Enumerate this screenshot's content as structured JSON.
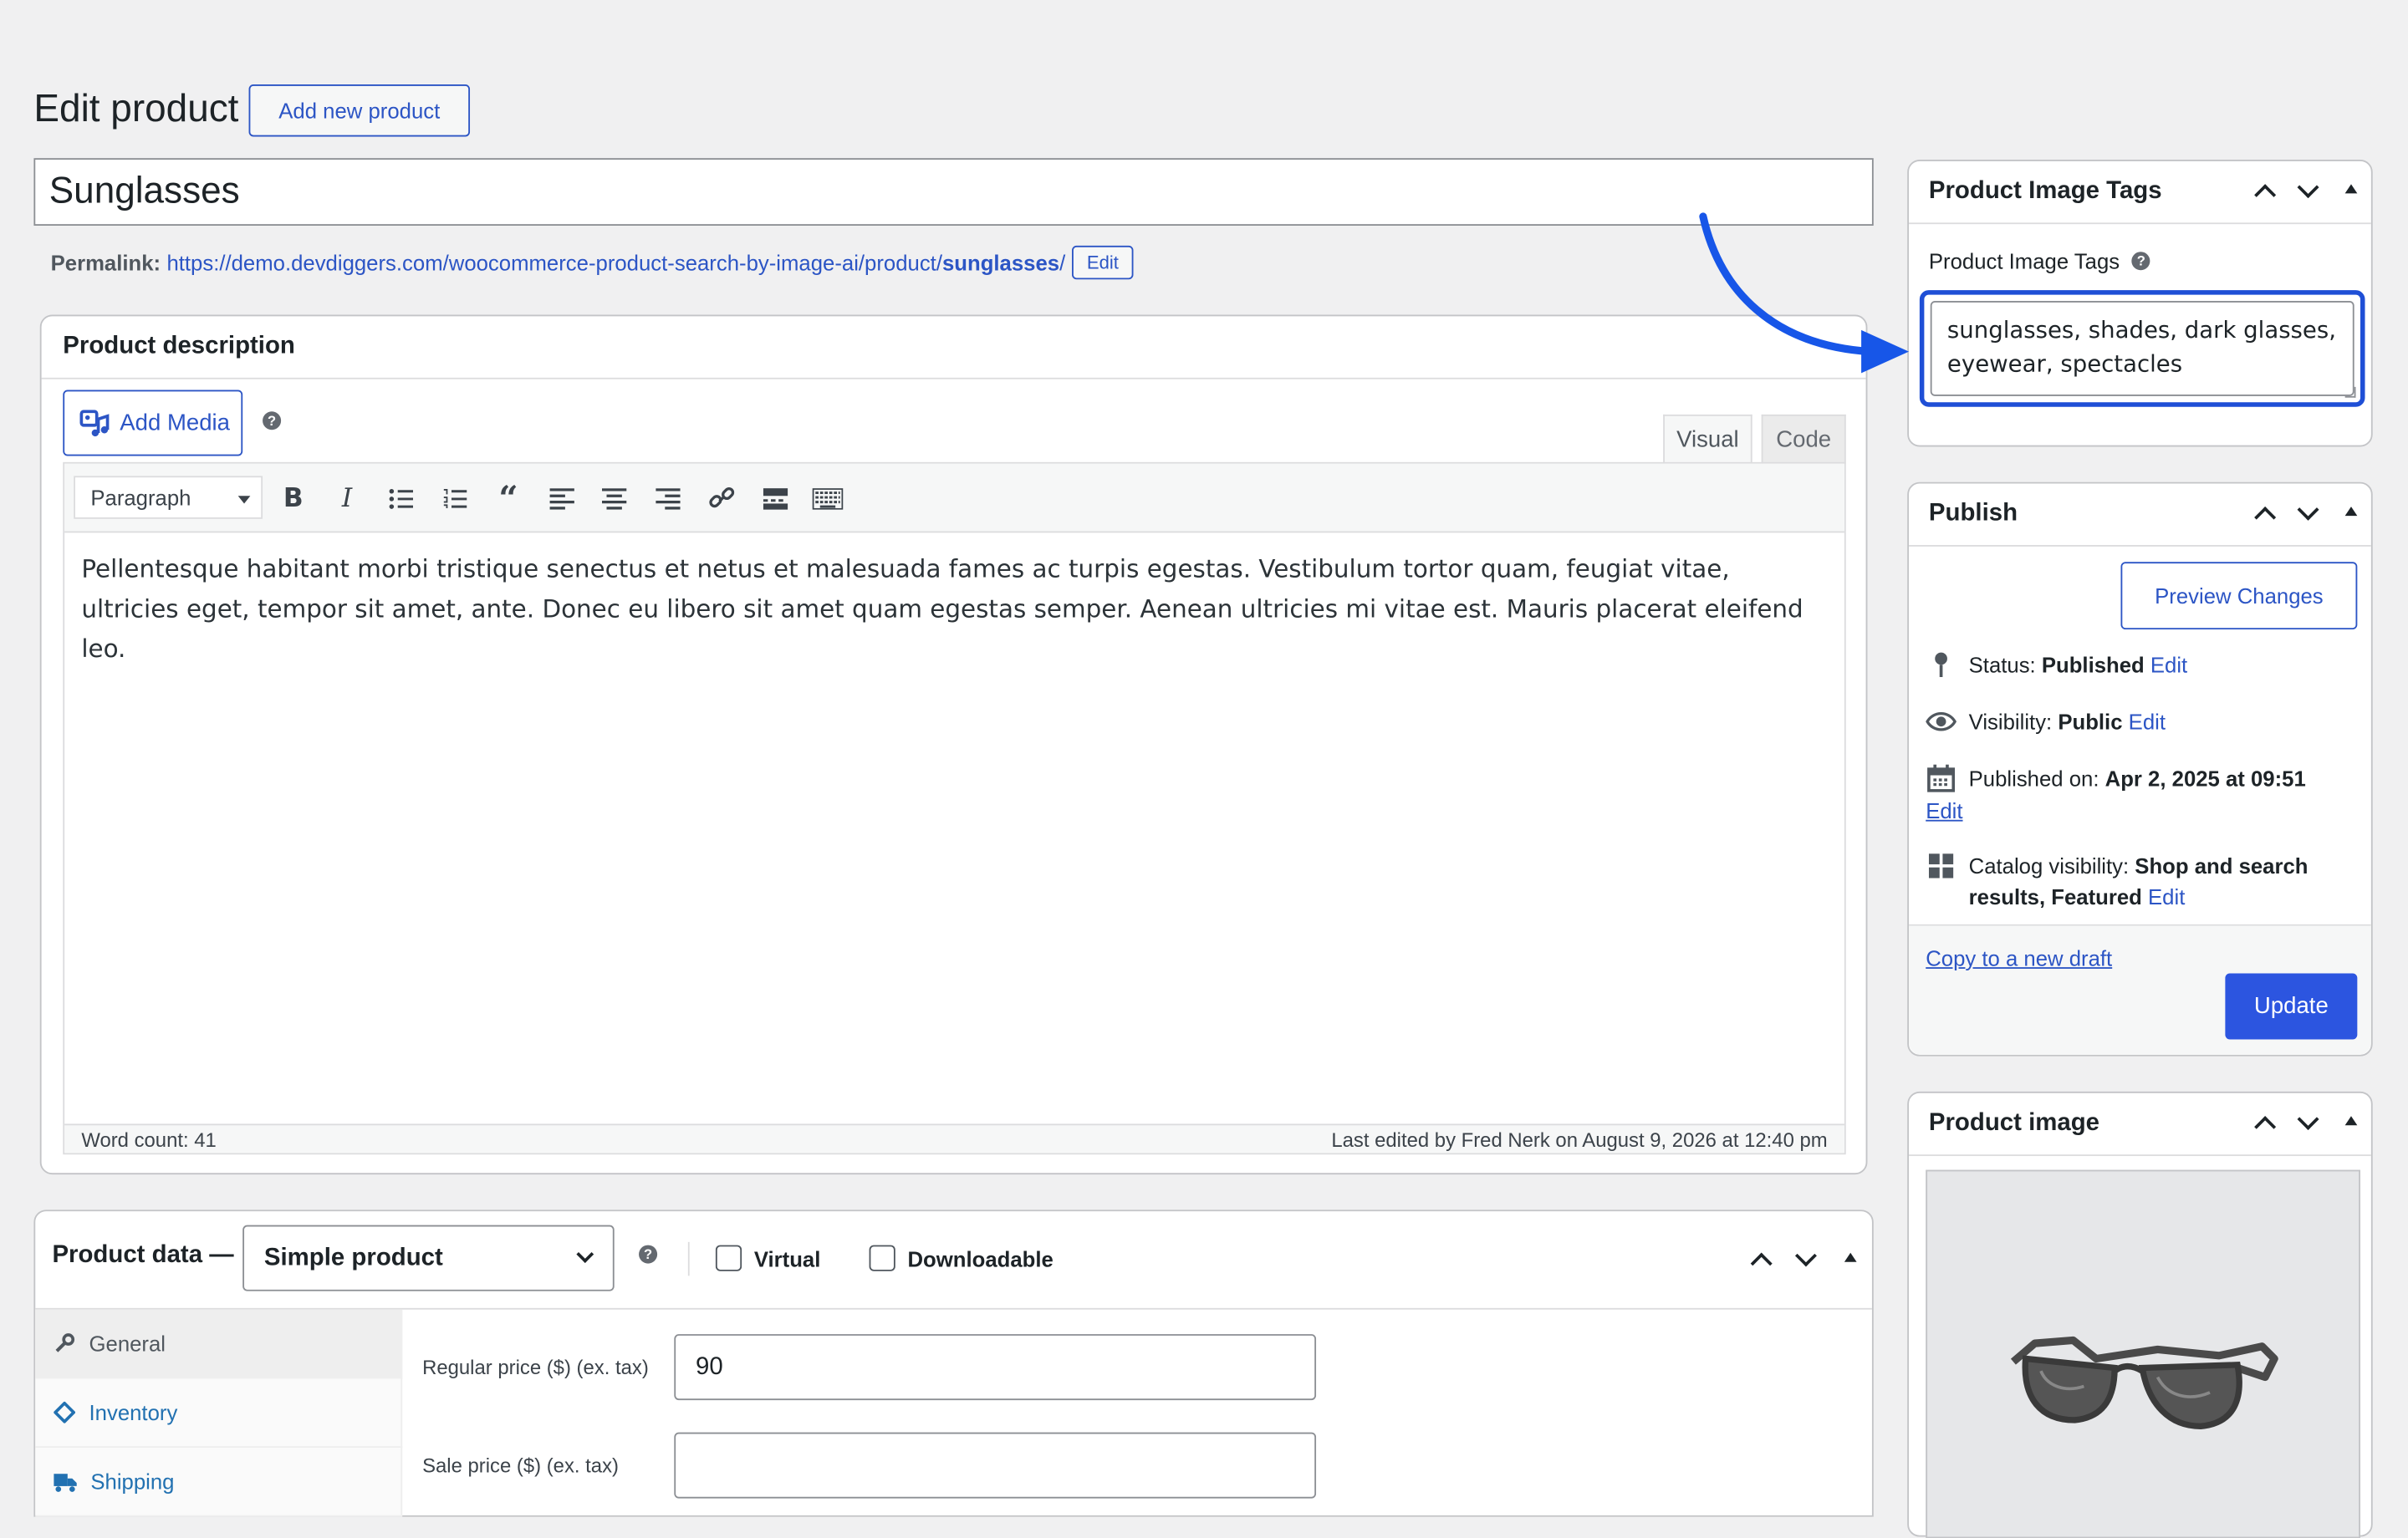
{
  "header": {
    "title": "Edit product",
    "add_new_label": "Add new product"
  },
  "post": {
    "title_value": "Sunglasses",
    "permalink_label": "Permalink:",
    "permalink_base": "https://demo.devdiggers.com/woocommerce-product-search-by-image-ai/product/",
    "permalink_slug": "sunglasses",
    "permalink_trailing": "/",
    "permalink_edit": "Edit"
  },
  "description": {
    "heading": "Product description",
    "add_media_label": "Add Media",
    "help_glyph": "?",
    "tab_visual": "Visual",
    "tab_code": "Code",
    "format_value": "Paragraph",
    "toolbar_icons": [
      "bold-icon",
      "italic-icon",
      "bullet-list-icon",
      "numbered-list-icon",
      "blockquote-icon",
      "align-left-icon",
      "align-center-icon",
      "align-right-icon",
      "link-icon",
      "read-more-icon",
      "toolbar-toggle-icon"
    ],
    "body": "Pellentesque habitant morbi tristique senectus et netus et malesuada fames ac turpis egestas. Vestibulum tortor quam, feugiat vitae, ultricies eget, tempor sit amet, ante. Donec eu libero sit amet quam egestas semper. Aenean ultricies mi vitae est. Mauris placerat eleifend leo.",
    "word_count": "Word count: 41",
    "last_edited": "Last edited by Fred Nerk on August 9, 2026 at 12:40 pm"
  },
  "product_data": {
    "label": "Product data —",
    "type_value": "Simple product",
    "virtual_label": "Virtual",
    "downloadable_label": "Downloadable",
    "tabs": [
      {
        "label": "General",
        "icon": "wrench-icon"
      },
      {
        "label": "Inventory",
        "icon": "tag-icon"
      },
      {
        "label": "Shipping",
        "icon": "truck-icon"
      }
    ],
    "regular_price_label": "Regular price ($) (ex. tax)",
    "regular_price_value": "90",
    "sale_price_label": "Sale price ($) (ex. tax)",
    "sale_price_value": ""
  },
  "image_tags": {
    "heading": "Product Image Tags",
    "field_label": "Product Image Tags",
    "value": "sunglasses, shades, dark glasses, eyewear, spectacles"
  },
  "publish": {
    "heading": "Publish",
    "preview_label": "Preview Changes",
    "status_label": "Status:",
    "status_value": "Published",
    "visibility_label": "Visibility:",
    "visibility_value": "Public",
    "published_label": "Published on:",
    "published_value": "Apr 2, 2025 at 09:51",
    "catalog_label": "Catalog visibility:",
    "catalog_value": "Shop and search results, Featured",
    "edit_link": "Edit",
    "copy_draft": "Copy to a new draft",
    "update_label": "Update"
  },
  "product_image": {
    "heading": "Product image"
  },
  "colors": {
    "accent": "#2c55e0",
    "focus_ring": "#1f4fd6",
    "arrow": "#1756e8"
  }
}
